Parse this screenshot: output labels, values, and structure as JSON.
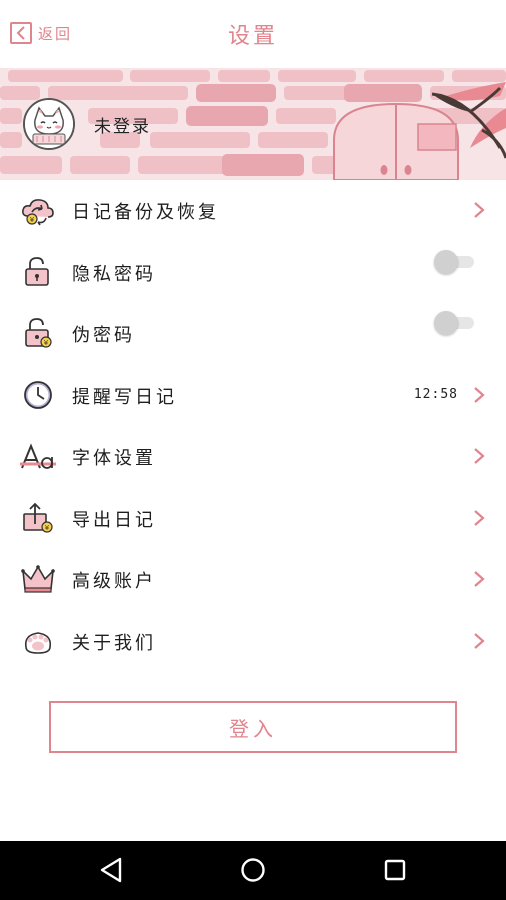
{
  "header": {
    "back_label": "返回",
    "title": "设置"
  },
  "profile": {
    "status": "未登录"
  },
  "settings": [
    {
      "label": "日记备份及恢复",
      "control": "chevron",
      "icon": "cloud-sync-icon"
    },
    {
      "label": "隐私密码",
      "control": "toggle",
      "on": false,
      "icon": "lock-icon"
    },
    {
      "label": "伪密码",
      "control": "toggle",
      "on": false,
      "icon": "lock-coin-icon"
    },
    {
      "label": "提醒写日记",
      "control": "chevron",
      "value": "12:58",
      "icon": "clock-icon"
    },
    {
      "label": "字体设置",
      "control": "chevron",
      "icon": "font-icon"
    },
    {
      "label": "导出日记",
      "control": "chevron",
      "icon": "export-icon"
    },
    {
      "label": "高级账户",
      "control": "chevron",
      "icon": "crown-icon"
    },
    {
      "label": "关于我们",
      "control": "chevron",
      "icon": "paw-icon"
    }
  ],
  "login_button": "登入",
  "colors": {
    "accent": "#e0848d",
    "banner_bg": "#f6e4e6",
    "brick": "#efc0c6",
    "navbar": "#000000"
  }
}
